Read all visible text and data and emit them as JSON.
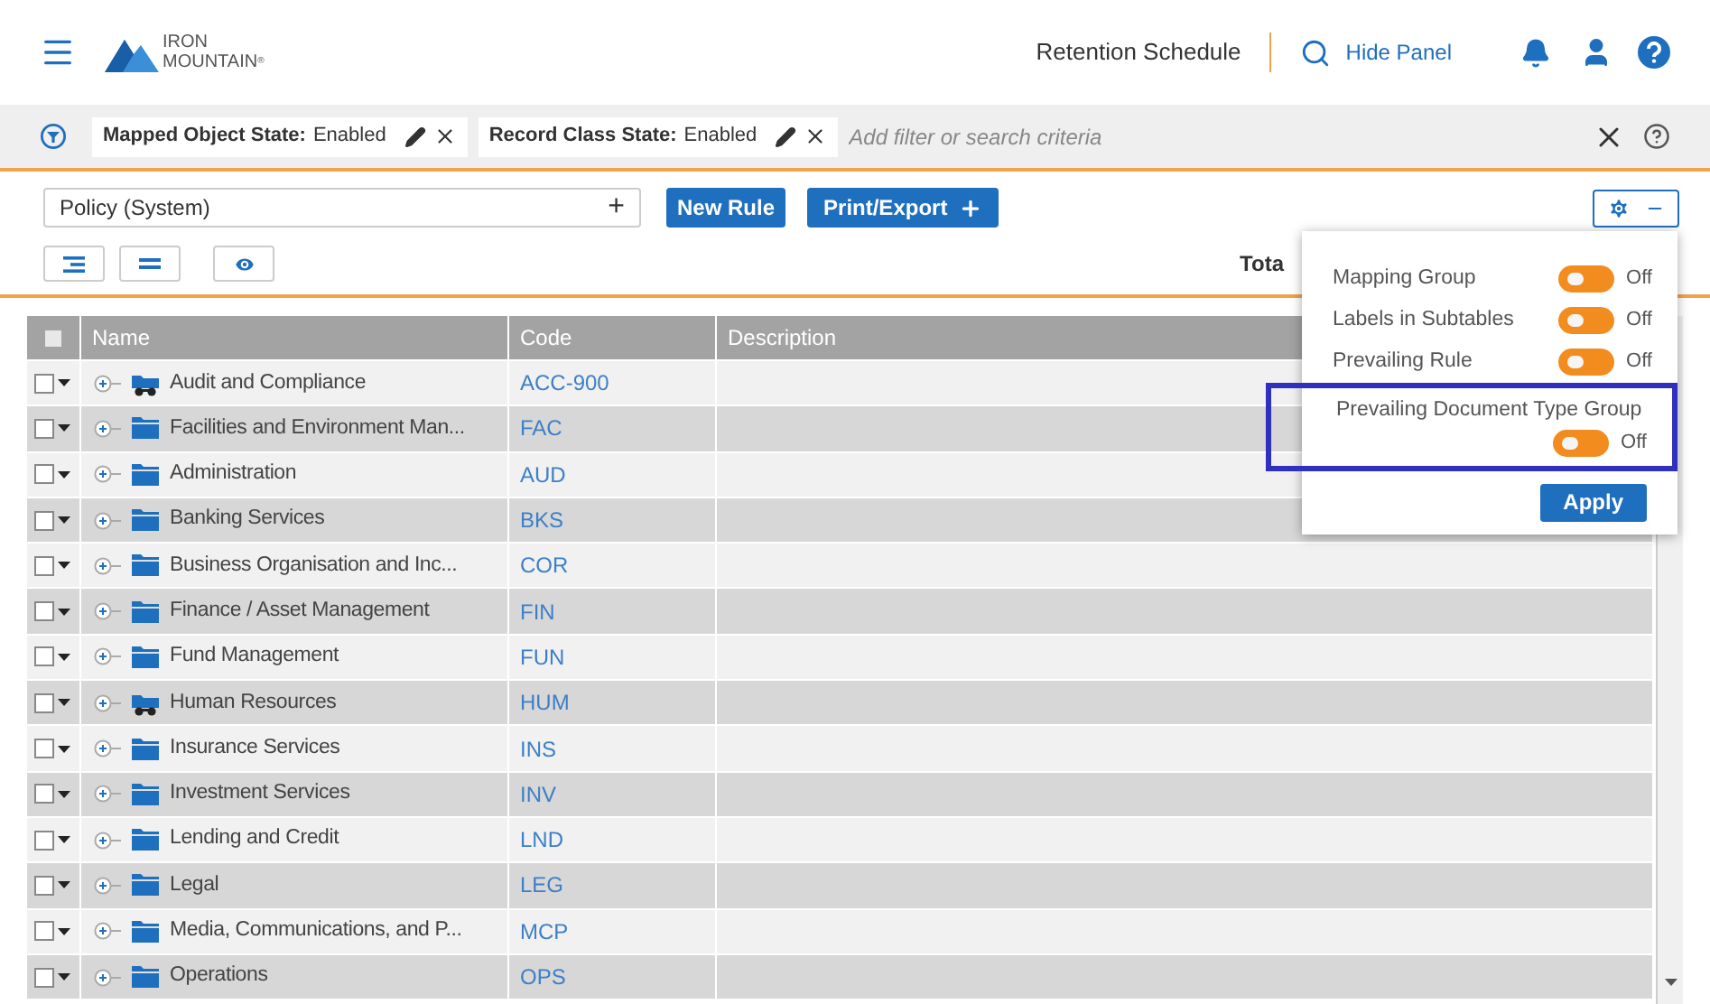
{
  "header": {
    "logo_line_1": "IRON",
    "logo_line_2": "MOUNTAIN",
    "logo_mark": "®",
    "page_title": "Retention Schedule",
    "hide_panel": "Hide Panel"
  },
  "filter_bar": {
    "chips": [
      {
        "label": "Mapped Object State:",
        "value": "Enabled"
      },
      {
        "label": "Record Class State:",
        "value": "Enabled"
      }
    ],
    "placeholder": "Add filter or search criteria"
  },
  "toolbar": {
    "policy_field": "Policy (System)",
    "plus": "+",
    "buttons": [
      {
        "label": "New Rule",
        "kind": "plain"
      },
      {
        "label": "Print/Export",
        "kind": "plus"
      }
    ],
    "total_text": "Tota"
  },
  "settings_popup": {
    "options": [
      {
        "label": "Mapping Group",
        "on": false,
        "state": "Off",
        "highlighted": false
      },
      {
        "label": "Labels in Subtables",
        "on": false,
        "state": "Off",
        "highlighted": false
      },
      {
        "label": "Prevailing Rule",
        "on": false,
        "state": "Off",
        "highlighted": false
      },
      {
        "label": "Prevailing Document Type Group",
        "on": false,
        "state": "Off",
        "highlighted": true
      }
    ],
    "apply": "Apply"
  },
  "table": {
    "select_all_checked": false,
    "columns": [
      "Name",
      "Code",
      "Description"
    ],
    "rows": [
      {
        "name": "Audit and Compliance",
        "code": "ACC-900",
        "kind": "special",
        "checked": false
      },
      {
        "name": "Facilities and Environment Man...",
        "code": "FAC",
        "kind": "folder",
        "checked": false
      },
      {
        "name": "Administration",
        "code": "AUD",
        "kind": "folder",
        "checked": false
      },
      {
        "name": "Banking Services",
        "code": "BKS",
        "kind": "folder",
        "checked": false
      },
      {
        "name": "Business Organisation and Inc...",
        "code": "COR",
        "kind": "folder",
        "checked": false
      },
      {
        "name": "Finance / Asset Management",
        "code": "FIN",
        "kind": "folder",
        "checked": false
      },
      {
        "name": "Fund Management",
        "code": "FUN",
        "kind": "folder",
        "checked": false
      },
      {
        "name": "Human Resources",
        "code": "HUM",
        "kind": "special",
        "checked": false
      },
      {
        "name": "Insurance Services",
        "code": "INS",
        "kind": "folder",
        "checked": false
      },
      {
        "name": "Investment Services",
        "code": "INV",
        "kind": "folder",
        "checked": false
      },
      {
        "name": "Lending and Credit",
        "code": "LND",
        "kind": "folder",
        "checked": false
      },
      {
        "name": "Legal",
        "code": "LEG",
        "kind": "folder",
        "checked": false
      },
      {
        "name": "Media, Communications, and P...",
        "code": "MCP",
        "kind": "folder",
        "checked": false
      },
      {
        "name": "Operations",
        "code": "OPS",
        "kind": "folder",
        "checked": false
      }
    ]
  }
}
